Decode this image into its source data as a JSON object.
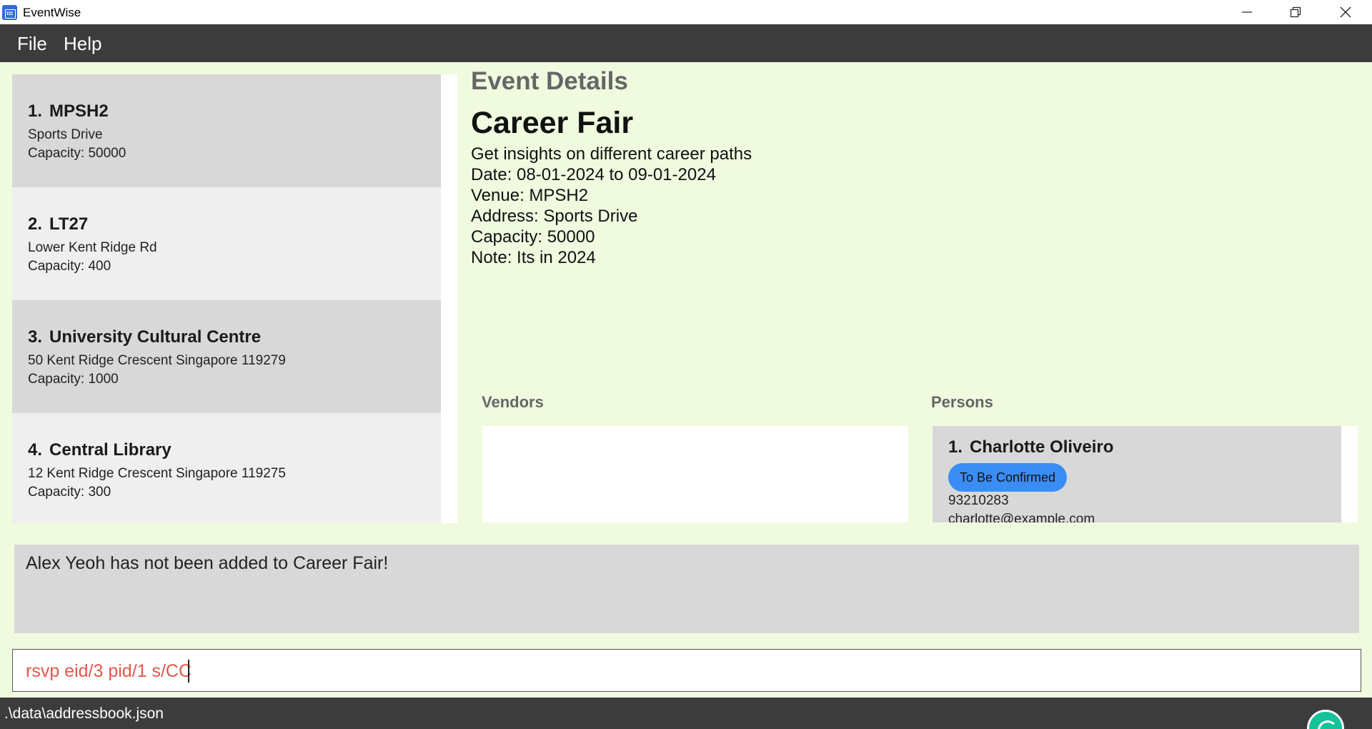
{
  "window": {
    "title": "EventWise"
  },
  "menu": {
    "file": "File",
    "help": "Help"
  },
  "venues": [
    {
      "index": "1.",
      "name": "MPSH2",
      "address": "Sports Drive",
      "capacity": "Capacity: 50000"
    },
    {
      "index": "2.",
      "name": "LT27",
      "address": "Lower Kent Ridge Rd",
      "capacity": "Capacity: 400"
    },
    {
      "index": "3.",
      "name": "University Cultural Centre",
      "address": "50 Kent Ridge Crescent Singapore 119279",
      "capacity": "Capacity: 1000"
    },
    {
      "index": "4.",
      "name": "Central Library",
      "address": "12 Kent Ridge Crescent Singapore 119275",
      "capacity": "Capacity: 300"
    }
  ],
  "event_details": {
    "section_title": "Event Details",
    "name": "Career Fair",
    "description": "Get insights on different career paths",
    "date": "Date: 08-01-2024 to 09-01-2024",
    "venue": "Venue: MPSH2",
    "address": "Address: Sports Drive",
    "capacity": "Capacity: 50000",
    "note": "Note: Its in 2024"
  },
  "vendors": {
    "title": "Vendors"
  },
  "persons": {
    "title": "Persons",
    "items": [
      {
        "index": "1.",
        "name": "Charlotte Oliveiro",
        "status": "To Be Confirmed",
        "phone": "93210283",
        "email": "charlotte@example.com"
      }
    ]
  },
  "result": {
    "message": "Alex Yeoh has not been added to Career Fair!"
  },
  "command": {
    "value": "rsvp eid/3 pid/1 s/CC"
  },
  "status_bar": {
    "path": ".\\data\\addressbook.json"
  },
  "colors": {
    "menubar": "#3c3c3c",
    "background": "#f0fadf",
    "badge": "#3a8df5",
    "command_text": "#e2574c"
  }
}
